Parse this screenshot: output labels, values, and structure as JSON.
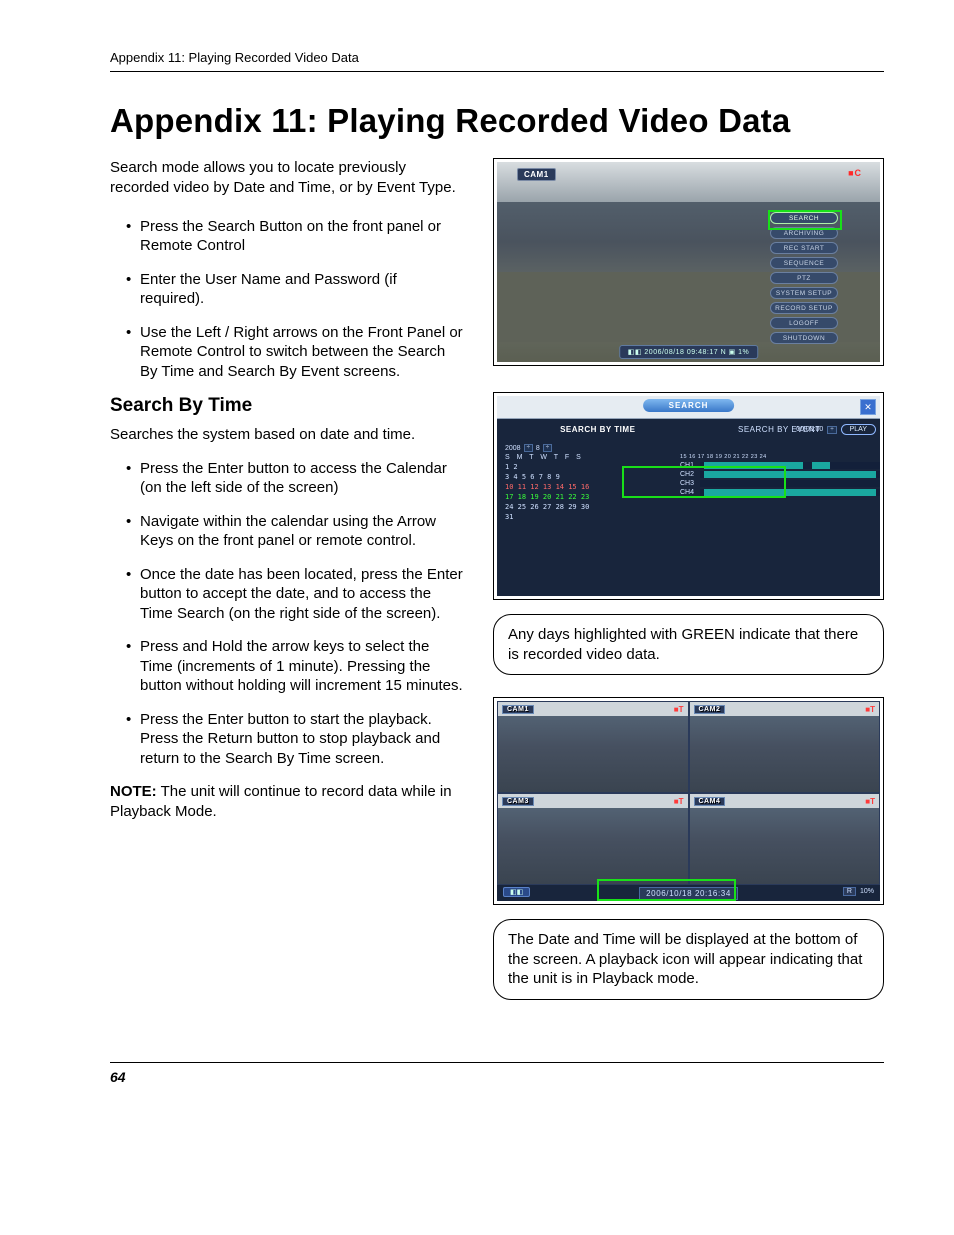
{
  "header": {
    "running": "Appendix 11: Playing Recorded Video Data"
  },
  "title": "Appendix 11: Playing Recorded Video Data",
  "intro": "Search mode allows you to locate previously recorded video by Date and Time, or by Event Type.",
  "bullets_top": [
    "Press the Search Button on the front panel or Remote Control",
    "Enter the User Name and Password (if required).",
    "Use the Left / Right arrows on the Front Panel or Remote Control to switch between the Search By Time and Search By Event screens."
  ],
  "section2": {
    "heading": "Search By Time",
    "lead": "Searches the system based on date and time.",
    "bullets": [
      "Press the Enter button to access the Calendar (on the left side of the screen)",
      "Navigate within the calendar using the Arrow Keys on the front panel or remote control.",
      "Once the date has been located, press the Enter button to accept the date, and to access the Time Search (on the right side of the screen).",
      "Press and Hold the arrow keys to select the Time (increments of 1 minute). Pressing the button without holding will increment 15 minutes.",
      "Press the Enter button to start the playback. Press the Return button to stop playback and return to the Search By Time screen."
    ],
    "note_label": "NOTE:",
    "note_text": " The unit will continue to record data while in Playback Mode."
  },
  "fig1": {
    "cam": "CAM1",
    "rec": "■C",
    "menu": [
      "SEARCH",
      "ARCHIVING",
      "REC START",
      "SEQUENCE",
      "PTZ",
      "SYSTEM SETUP",
      "RECORD SETUP",
      "LOGOFF",
      "SHUTDOWN"
    ],
    "status": "◧◧   2006/08/18 09:48:17  N ▣ 1%"
  },
  "fig2": {
    "title": "SEARCH",
    "tab_time": "SEARCH BY TIME",
    "tab_event": "SEARCH BY EVENT",
    "year": "2008",
    "month": "8",
    "dow": "S  M  T  W  T  F  S",
    "cal_rows": [
      "                1  2",
      " 3  4  5  6  7  8  9",
      "10 11 12 13 14 15 16",
      "17 18 19 20 21 22 23",
      "24 25 26 27 28 29 30",
      "31"
    ],
    "time": "00:00:00",
    "play": "PLAY",
    "scale": "15 16 17 18 19 20 21 22 23 24",
    "channels": [
      "CH1",
      "CH2",
      "CH3",
      "CH4"
    ]
  },
  "callout1": "Any days highlighted with GREEN indicate that there is recorded video data.",
  "fig3": {
    "cams": [
      "CAM1",
      "CAM2",
      "CAM3",
      "CAM4"
    ],
    "rec": "■T",
    "time": "2006/10/18 20:16:34",
    "left": "◧◧",
    "right_r": "R",
    "right_pct": "10%"
  },
  "callout2": "The Date and Time will be displayed at the bottom of the screen. A playback icon will appear indicating that the unit is in Playback mode.",
  "page_number": "64"
}
